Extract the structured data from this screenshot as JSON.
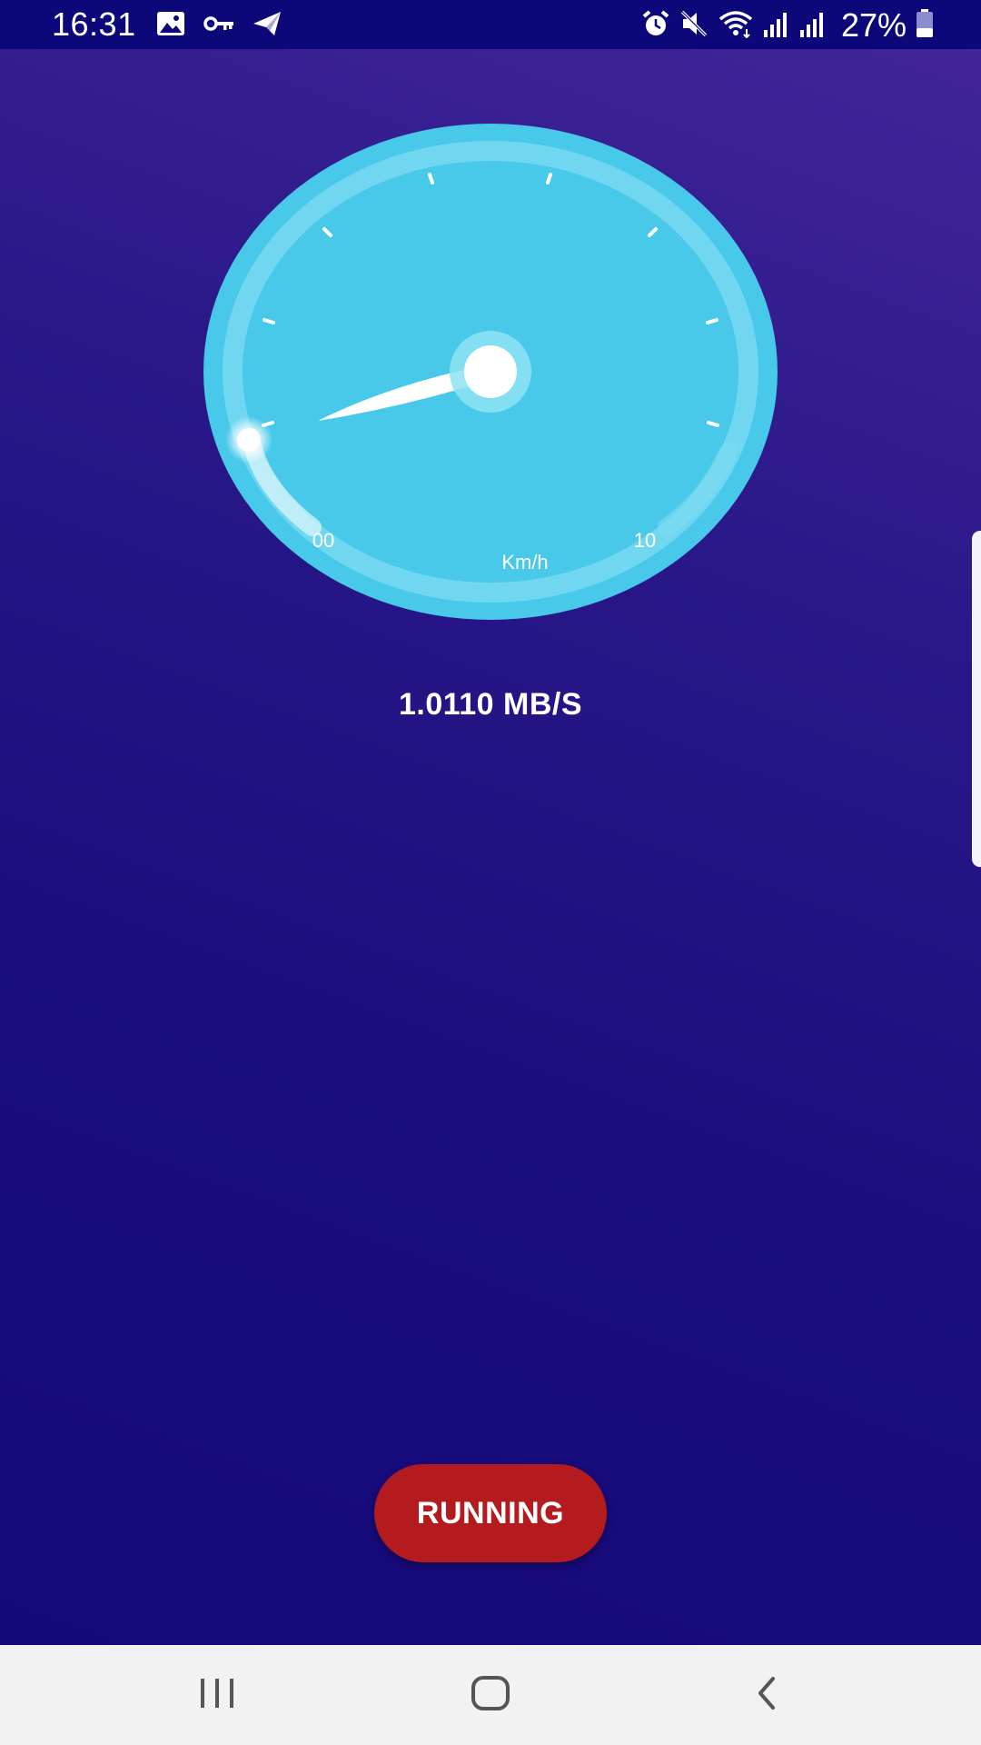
{
  "status_bar": {
    "time": "16:31",
    "battery_percent": "27%",
    "left_icons": [
      "gallery-icon",
      "key-icon",
      "send-icon"
    ],
    "right_icons": [
      "alarm-icon",
      "mute-icon",
      "wifi-icon",
      "signal-icon",
      "signal-icon",
      "battery-icon"
    ]
  },
  "gauge": {
    "min_label": "00",
    "max_label": "10",
    "unit": "Km/h",
    "level": 0.0
  },
  "speed": {
    "readout": "1.0110 MB/S"
  },
  "action": {
    "label": "RUNNING",
    "color": "#b31b1e"
  },
  "nav": {
    "recents": "recents-icon",
    "home": "home-icon",
    "back": "back-icon"
  },
  "colors": {
    "gauge_face": "#48c9ea",
    "status_bar": "#0c087a",
    "nav_bar": "#f2f2f2"
  }
}
